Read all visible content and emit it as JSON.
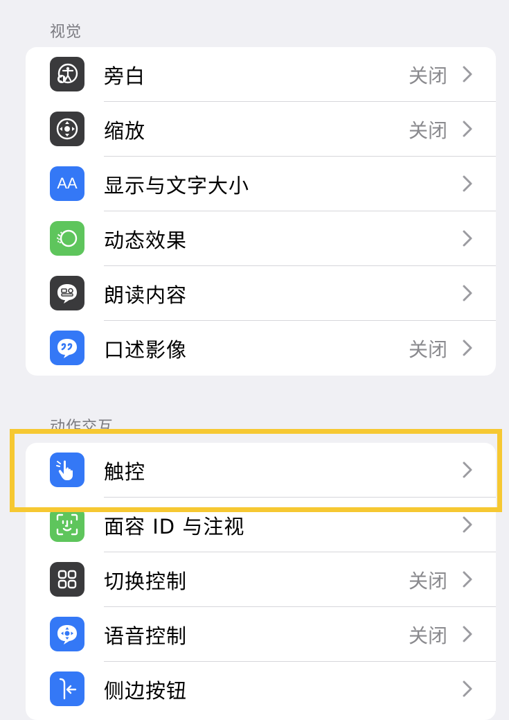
{
  "sections": {
    "vision": {
      "header": "视觉",
      "rows": [
        {
          "label": "旁白",
          "value": "关闭",
          "icon": "voiceover-icon"
        },
        {
          "label": "缩放",
          "value": "关闭",
          "icon": "zoom-icon"
        },
        {
          "label": "显示与文字大小",
          "value": "",
          "icon": "text-size-icon",
          "icon_text": "AA"
        },
        {
          "label": "动态效果",
          "value": "",
          "icon": "motion-icon"
        },
        {
          "label": "朗读内容",
          "value": "",
          "icon": "spoken-content-icon"
        },
        {
          "label": "口述影像",
          "value": "关闭",
          "icon": "audio-description-icon"
        }
      ]
    },
    "interaction": {
      "header": "动作交互",
      "rows": [
        {
          "label": "触控",
          "value": "",
          "icon": "touch-icon"
        },
        {
          "label": "面容 ID 与注视",
          "value": "",
          "icon": "face-id-icon"
        },
        {
          "label": "切换控制",
          "value": "关闭",
          "icon": "switch-control-icon"
        },
        {
          "label": "语音控制",
          "value": "关闭",
          "icon": "voice-control-icon"
        },
        {
          "label": "侧边按钮",
          "value": "",
          "icon": "side-button-icon"
        }
      ]
    }
  },
  "colors": {
    "background": "#f0f0f4",
    "dark_icon": "#3a3a3c",
    "blue_icon": "#3478f6",
    "green_icon": "#5ec55c",
    "highlight": "#f6c832"
  }
}
